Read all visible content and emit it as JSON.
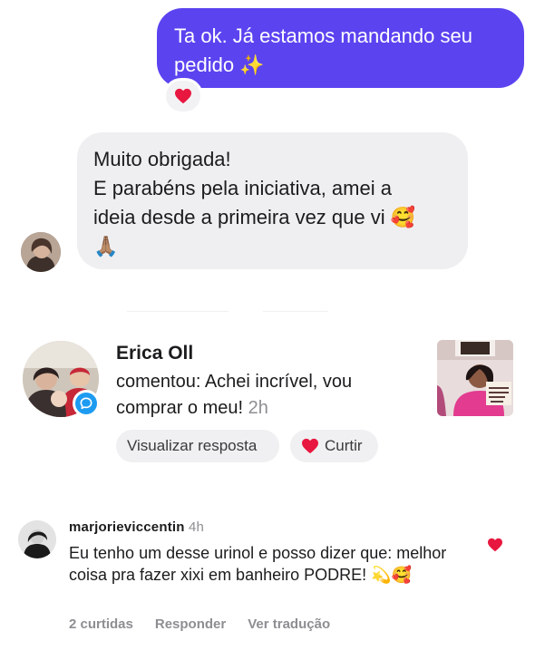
{
  "chat": {
    "outgoing": {
      "text": "Ta ok. Já estamos mandando seu pedido",
      "emoji": "✨",
      "reaction_icon": "heart-icon"
    },
    "incoming": {
      "line1": "Muito obrigada!",
      "line2": "E parabéns pela iniciativa, amei a",
      "line3": "ideia desde a primeira vez que vi",
      "emoji1": "🥰",
      "emoji2": "🙏🏽"
    }
  },
  "notification": {
    "name": "Erica Oll",
    "text": "comentou: Achei incrível, vou comprar o meu!",
    "time": "2h",
    "reply_button": "Visualizar resposta",
    "like_button": "Curtir",
    "badge_icon": "comment-bubble-icon"
  },
  "comment": {
    "username": "marjorieviccentin",
    "time": "4h",
    "text": "Eu tenho um desse urinol e posso dizer que: melhor coisa pra fazer xixi em banheiro PODRE!",
    "emojis": "💫🥰",
    "likes": "2 curtidas",
    "reply": "Responder",
    "translate": "Ver tradução"
  },
  "colors": {
    "accent_purple": "#5b43f0",
    "heart_red": "#e8173f",
    "badge_blue": "#1d9bf0"
  }
}
